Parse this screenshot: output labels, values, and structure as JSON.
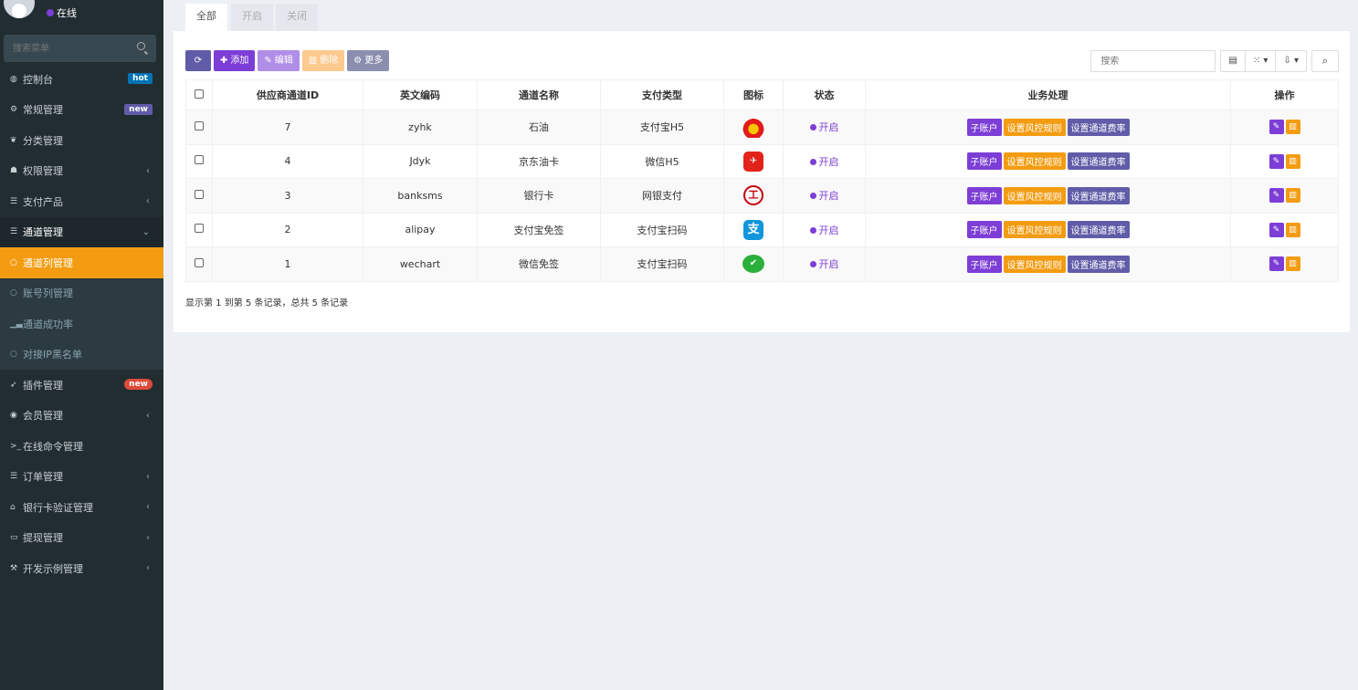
{
  "user": {
    "status": "在线"
  },
  "sidebar": {
    "search_placeholder": "搜索菜单",
    "items": [
      {
        "label": "控制台",
        "icon": "dashboard-icon",
        "glyph": "◍",
        "badge": "hot",
        "badge_color": "#0073b7"
      },
      {
        "label": "常规管理",
        "icon": "cogs-icon",
        "glyph": "⚙",
        "badge": "new",
        "badge_color": "#605ca8"
      },
      {
        "label": "分类管理",
        "icon": "leaf-icon",
        "glyph": "❦"
      },
      {
        "label": "权限管理",
        "icon": "group-icon",
        "glyph": "☗",
        "arrow": "‹"
      },
      {
        "label": "支付产品",
        "icon": "list-icon",
        "glyph": "☰",
        "arrow": "‹"
      },
      {
        "label": "通道管理",
        "icon": "list-icon",
        "glyph": "☰",
        "arrow": "⌄",
        "open": true
      },
      {
        "label": "通道列管理",
        "icon": "circle-icon",
        "glyph": "○",
        "active": true
      },
      {
        "label": "账号列管理",
        "icon": "circle-icon",
        "glyph": "○",
        "sub": true
      },
      {
        "label": "通道成功率",
        "icon": "signal-icon",
        "glyph": "▁▃",
        "sub": true
      },
      {
        "label": "对接IP黑名单",
        "icon": "circle-icon",
        "glyph": "○",
        "sub": true
      },
      {
        "label": "插件管理",
        "icon": "rocket-icon",
        "glyph": "➶",
        "badge": "new",
        "badge_color": "#dd4b39"
      },
      {
        "label": "会员管理",
        "icon": "user-circle-icon",
        "glyph": "◉",
        "arrow": "‹"
      },
      {
        "label": "在线命令管理",
        "icon": "terminal-icon",
        "glyph": ">_"
      },
      {
        "label": "订单管理",
        "icon": "list-icon",
        "glyph": "☰",
        "arrow": "‹"
      },
      {
        "label": "银行卡验证管理",
        "icon": "bank-icon",
        "glyph": "⌂",
        "arrow": "‹"
      },
      {
        "label": "提现管理",
        "icon": "card-icon",
        "glyph": "▭",
        "arrow": "‹"
      },
      {
        "label": "开发示例管理",
        "icon": "magic-icon",
        "glyph": "⚒",
        "arrow": "‹"
      }
    ]
  },
  "tabs": [
    "全部",
    "开启",
    "关闭"
  ],
  "toolbar": {
    "refresh": "",
    "add": "添加",
    "edit": "编辑",
    "delete": "删除",
    "more": "更多",
    "search_placeholder": "搜索"
  },
  "colors": {
    "purple": "#7c3ed6",
    "orange": "#f39c12",
    "slate": "#605ca8",
    "lilac": "#b08ee8",
    "peach": "#fcc98e",
    "grey": "#8a8fb0"
  },
  "table": {
    "headers": [
      "供应商通道ID",
      "英文编码",
      "通道名称",
      "支付类型",
      "图标",
      "状态",
      "业务处理",
      "操作"
    ],
    "rows": [
      {
        "id": "7",
        "code": "zyhk",
        "name": "石油",
        "type": "支付宝H5",
        "icon": "petrochina-icon",
        "status": "开启"
      },
      {
        "id": "4",
        "code": "Jdyk",
        "name": "京东油卡",
        "type": "微信H5",
        "icon": "jd-icon",
        "status": "开启"
      },
      {
        "id": "3",
        "code": "banksms",
        "name": "银行卡",
        "type": "网银支付",
        "icon": "icbc-icon",
        "status": "开启"
      },
      {
        "id": "2",
        "code": "alipay",
        "name": "支付宝免签",
        "type": "支付宝扫码",
        "icon": "alipay-icon",
        "status": "开启"
      },
      {
        "id": "1",
        "code": "wechart",
        "name": "微信免签",
        "type": "支付宝扫码",
        "icon": "wechat-icon",
        "status": "开启"
      }
    ],
    "actions": [
      "子账户",
      "设置风控规则",
      "设置通道费率"
    ]
  },
  "pager": "显示第 1 到第 5 条记录，总共 5 条记录"
}
